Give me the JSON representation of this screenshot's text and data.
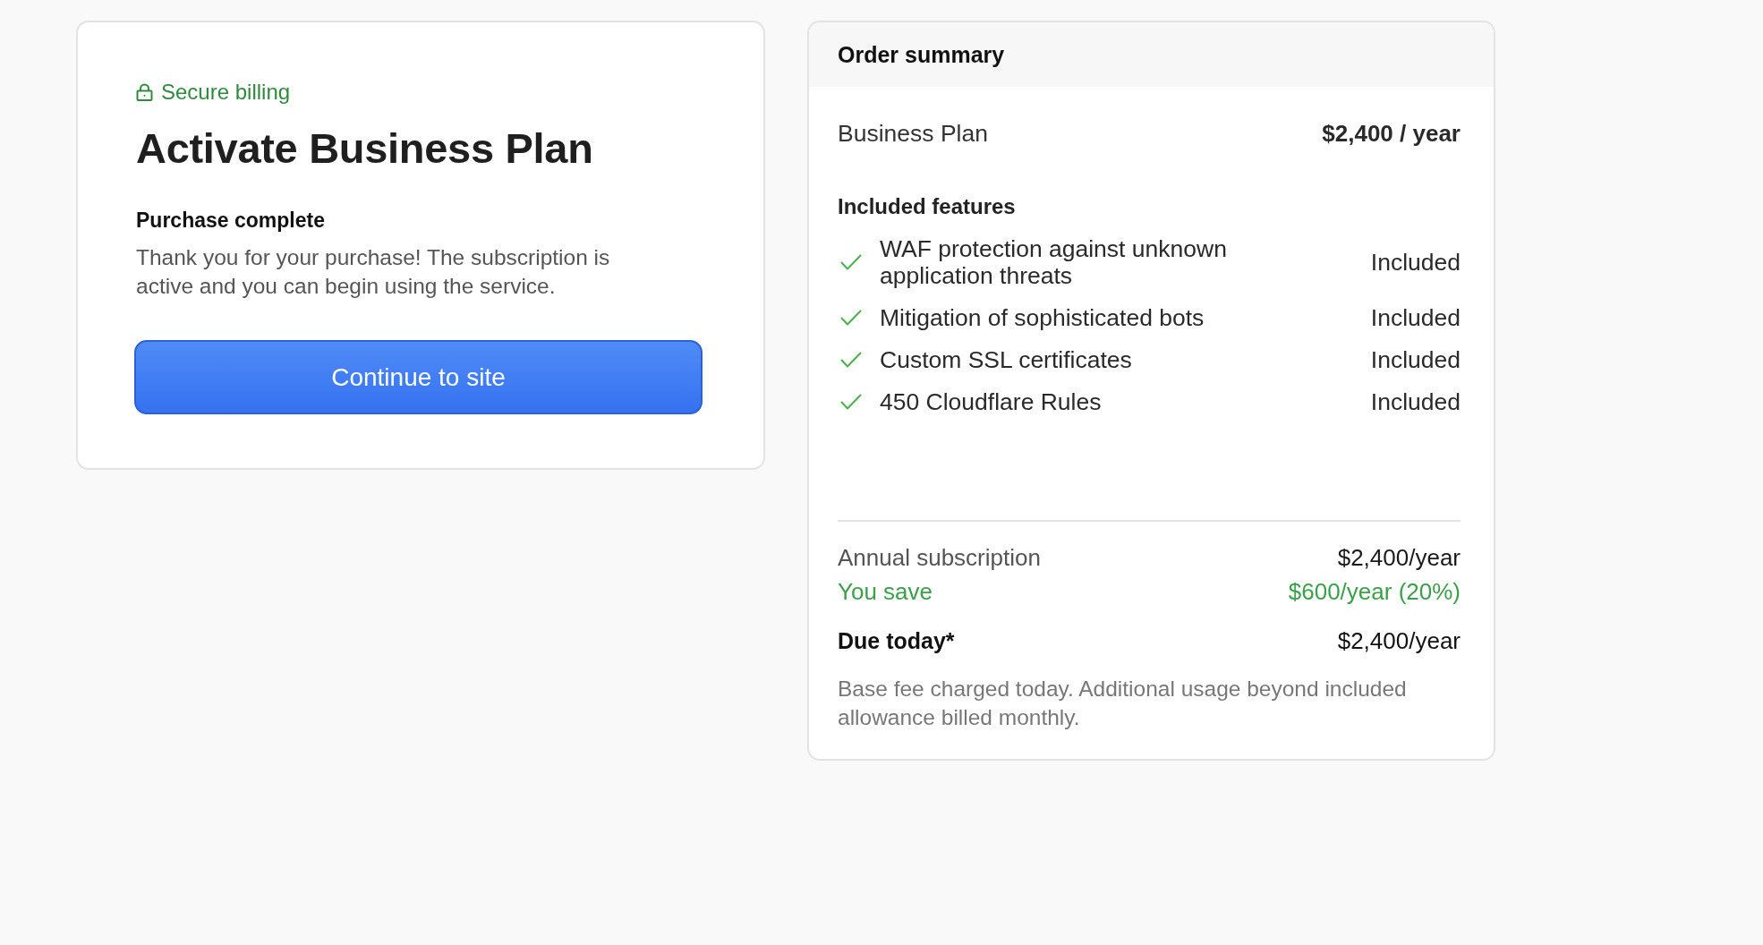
{
  "checkout": {
    "badge": {
      "label": "Secure billing"
    },
    "title": "Activate Business Plan",
    "status": {
      "heading": "Purchase complete",
      "message": "Thank you for your purchase! The subscription is active and you can begin using the service."
    },
    "button": {
      "label": "Continue to site"
    }
  },
  "order_summary": {
    "title": "Order summary",
    "plan": {
      "name": "Business Plan",
      "price": "$2,400 / year"
    },
    "features_heading": "Included features",
    "features": [
      {
        "name": "WAF protection against unknown application threats",
        "status": "Included"
      },
      {
        "name": "Mitigation of sophisticated bots",
        "status": "Included"
      },
      {
        "name": "Custom SSL certificates",
        "status": "Included"
      },
      {
        "name": "450 Cloudflare Rules",
        "status": "Included"
      }
    ],
    "totals": [
      {
        "kind": "regular",
        "label": "Annual subscription",
        "value": "$2,400/year"
      },
      {
        "kind": "savings",
        "label": "You save",
        "value": "$600/year (20%)"
      }
    ],
    "due": {
      "label": "Due today*",
      "value": "$2,400/year"
    },
    "note": "Base fee charged today. Additional usage beyond included allowance billed monthly."
  }
}
